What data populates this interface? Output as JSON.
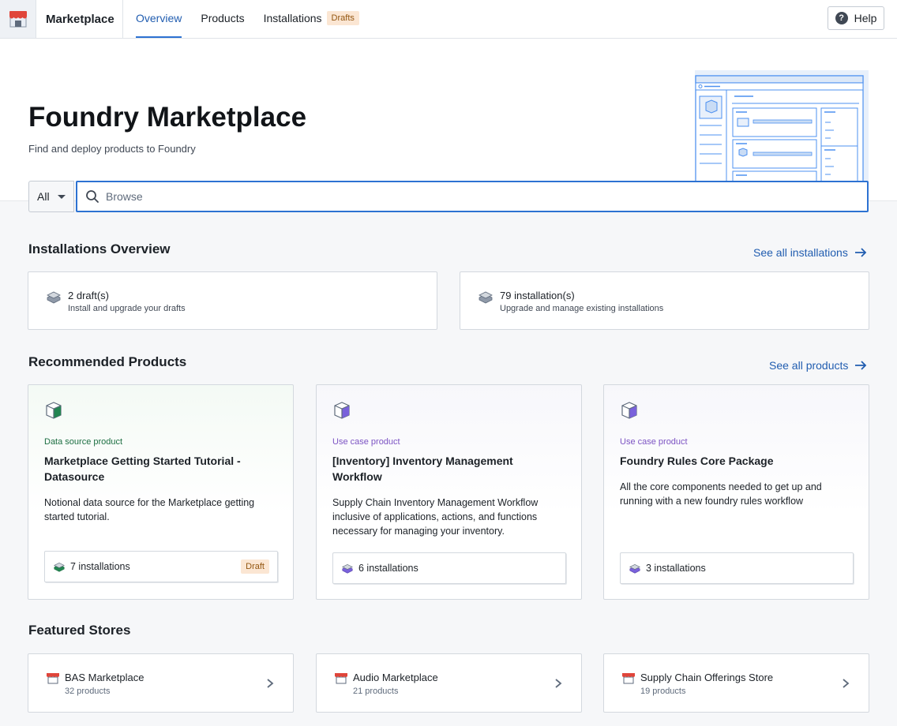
{
  "app": {
    "name": "Marketplace",
    "tabs": [
      {
        "label": "Overview",
        "active": true
      },
      {
        "label": "Products",
        "active": false
      },
      {
        "label": "Installations",
        "active": false,
        "badge": "Drafts"
      }
    ],
    "help_label": "Help"
  },
  "hero": {
    "title": "Foundry Marketplace",
    "subtitle": "Find and deploy products to Foundry"
  },
  "search": {
    "scope": "All",
    "placeholder": "Browse"
  },
  "installations_overview": {
    "title": "Installations Overview",
    "see_all": "See all installations",
    "cards": [
      {
        "main": "2 draft(s)",
        "sub": "Install and upgrade your drafts"
      },
      {
        "main": "79 installation(s)",
        "sub": "Upgrade and manage existing installations"
      }
    ]
  },
  "recommended": {
    "title": "Recommended Products",
    "see_all": "See all products",
    "products": [
      {
        "type": "Data source product",
        "name": "Marketplace Getting Started Tutorial - Datasource",
        "description": "Notional data source for the Marketplace getting started tutorial.",
        "installations": "7 installations",
        "badge": "Draft"
      },
      {
        "type": "Use case product",
        "name": "[Inventory] Inventory Management Workflow",
        "description": "Supply Chain Inventory Management Workflow inclusive of applications, actions, and functions necessary for managing your inventory.",
        "installations": "6 installations"
      },
      {
        "type": "Use case product",
        "name": "Foundry Rules Core Package",
        "description": "All the core components needed to get up and running with a new foundry rules workflow",
        "installations": "3 installations"
      }
    ]
  },
  "featured": {
    "title": "Featured Stores",
    "stores": [
      {
        "name": "BAS Marketplace",
        "count": "32 products"
      },
      {
        "name": "Audio Marketplace",
        "count": "21 products"
      },
      {
        "name": "Supply Chain Offerings Store",
        "count": "19 products"
      }
    ]
  },
  "colors": {
    "accent": "#2d72d2",
    "link": "#215db0",
    "draft_bg": "#fbe6d3",
    "draft_text": "#935610",
    "green_type": "#1c6e42",
    "purple_type": "#7c53c3",
    "store_red": "#e0453a"
  },
  "icons": {
    "logo": "store-icon",
    "help": "help-icon",
    "search": "search-icon",
    "arrow": "arrow-right-icon",
    "chevron": "chevron-right-icon",
    "install": "install-stack-icon",
    "product": "cube-icon",
    "store": "store-awning-icon"
  }
}
